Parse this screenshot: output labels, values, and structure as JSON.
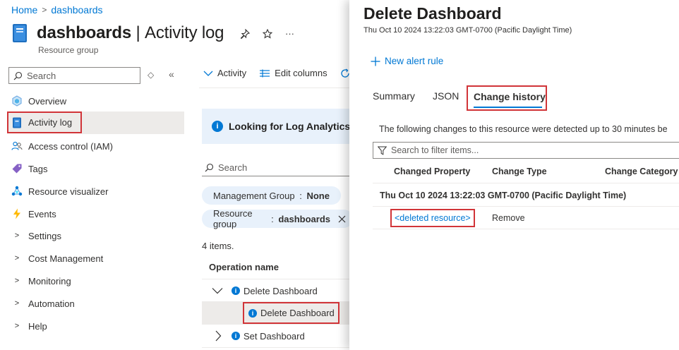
{
  "breadcrumb": {
    "home": "Home",
    "current": "dashboards",
    "separator": ">"
  },
  "header": {
    "title": "dashboards",
    "divider": "|",
    "blade_name": "Activity log",
    "subtitle": "Resource group",
    "more": "···"
  },
  "sidebar": {
    "search_placeholder": "Search",
    "items": [
      {
        "label": "Overview",
        "icon": "overview-icon"
      },
      {
        "label": "Activity log",
        "icon": "activity-log-icon"
      },
      {
        "label": "Access control (IAM)",
        "icon": "people-icon"
      },
      {
        "label": "Tags",
        "icon": "tag-icon"
      },
      {
        "label": "Resource visualizer",
        "icon": "visualizer-icon"
      },
      {
        "label": "Events",
        "icon": "bolt-icon"
      },
      {
        "label": "Settings",
        "icon": "chevron-right-icon"
      },
      {
        "label": "Cost Management",
        "icon": "chevron-right-icon"
      },
      {
        "label": "Monitoring",
        "icon": "chevron-right-icon"
      },
      {
        "label": "Automation",
        "icon": "chevron-right-icon"
      },
      {
        "label": "Help",
        "icon": "chevron-right-icon"
      }
    ]
  },
  "toolbar": {
    "activity": "Activity",
    "edit_columns": "Edit columns"
  },
  "banner": {
    "text": "Looking for Log Analytics?"
  },
  "main_search": {
    "placeholder": "Search"
  },
  "filters": [
    {
      "key": "Management Group",
      "value": "None"
    },
    {
      "key": "Resource group",
      "value": "dashboards"
    }
  ],
  "list": {
    "count": "4 items.",
    "column_header": "Operation name",
    "rows": [
      {
        "label": "Delete Dashboard"
      },
      {
        "label": "Delete Dashboard"
      },
      {
        "label": "Set Dashboard"
      }
    ]
  },
  "panel": {
    "title": "Delete Dashboard",
    "timestamp": "Thu Oct 10 2024 13:22:03 GMT-0700 (Pacific Daylight Time)",
    "new_alert_rule": "New alert rule",
    "tabs": [
      "Summary",
      "JSON",
      "Change history"
    ],
    "active_tab": "Change history",
    "changes_note": "The following changes to this resource were detected up to 30 minutes be",
    "filter_placeholder": "Search to filter items...",
    "columns": [
      "Changed Property",
      "Change Type",
      "Change Category"
    ],
    "group": "Thu Oct 10 2024 13:22:03 GMT-0700 (Pacific Daylight Time)",
    "change": {
      "property": "<deleted resource>",
      "type": "Remove"
    }
  },
  "colors": {
    "accent": "#0078d4",
    "highlight": "#d13438",
    "selected_bg": "#edebe9",
    "banner_bg": "#e8f1fb"
  }
}
